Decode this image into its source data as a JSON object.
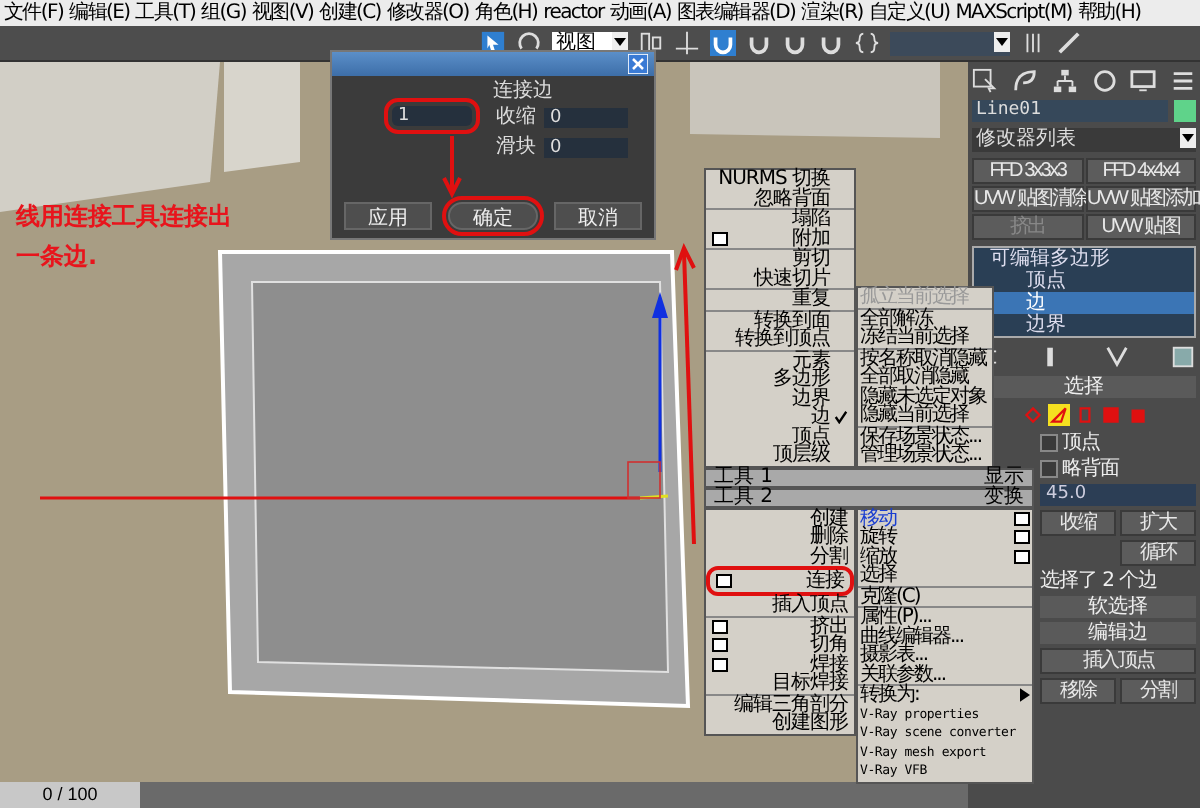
{
  "menu_bar": [
    "文件(F)",
    "编辑(E)",
    "工具(T)",
    "组(G)",
    "视图(V)",
    "创建(C)",
    "修改器(O)",
    "角色(H)",
    "reactor",
    "动画(A)",
    "图表编辑器(D)",
    "渲染(R)",
    "自定义(U)",
    "MAXScript(M)",
    "帮助(H)"
  ],
  "toolbar": {
    "view_dropdown": "视图"
  },
  "dialog": {
    "section_title": "连接边",
    "segments_value": "1",
    "segments_circled": true,
    "fields": [
      {
        "label": "收缩",
        "value": "0"
      },
      {
        "label": "滑块",
        "value": "0"
      }
    ],
    "buttons": [
      {
        "label": "应用",
        "circled": false
      },
      {
        "label": "确定",
        "circled": true
      },
      {
        "label": "取消",
        "circled": false
      }
    ]
  },
  "annotation": "线用连接工具连接出一条边.",
  "quad_menu": {
    "quadrants": [
      {
        "title": "工具 1",
        "groups": [
          [
            {
              "label": "NURMS 切换",
              "settings": false,
              "checked": false
            },
            {
              "label": "忽略背面",
              "settings": false,
              "checked": false
            }
          ],
          [
            {
              "label": "塌陷",
              "settings": false,
              "checked": false
            },
            {
              "label": "附加",
              "settings": true,
              "checked": false
            }
          ],
          [
            {
              "label": "剪切",
              "settings": false,
              "checked": false
            },
            {
              "label": "快速切片",
              "settings": false,
              "checked": false
            }
          ],
          [
            {
              "label": "重复",
              "settings": false,
              "checked": false
            }
          ],
          [
            {
              "label": "转换到面",
              "settings": false,
              "checked": false
            },
            {
              "label": "转换到顶点",
              "settings": false,
              "checked": false
            }
          ],
          [
            {
              "label": "元素",
              "settings": false,
              "checked": false
            },
            {
              "label": "多边形",
              "settings": false,
              "checked": false
            },
            {
              "label": "边界",
              "settings": false,
              "checked": false
            },
            {
              "label": "边",
              "settings": false,
              "checked": true
            },
            {
              "label": "顶点",
              "settings": false,
              "checked": false
            },
            {
              "label": "顶层级",
              "settings": false,
              "checked": false
            }
          ]
        ]
      },
      {
        "title": "显示",
        "groups": [
          [
            {
              "label": "孤立当前选择",
              "disabled": true
            }
          ],
          [
            {
              "label": "全部解冻",
              "disabled": false
            },
            {
              "label": "冻结当前选择",
              "disabled": false
            }
          ],
          [
            {
              "label": "按名称取消隐藏",
              "disabled": false
            },
            {
              "label": "全部取消隐藏",
              "disabled": false
            },
            {
              "label": "隐藏未选定对象",
              "disabled": false
            },
            {
              "label": "隐藏当前选择",
              "disabled": false
            }
          ],
          [
            {
              "label": "保存场景状态...",
              "disabled": false
            },
            {
              "label": "管理场景状态...",
              "disabled": false
            }
          ]
        ]
      },
      {
        "title": "工具 2",
        "groups": [
          [
            {
              "label": "创建",
              "settings": false,
              "circled": false
            },
            {
              "label": "删除",
              "settings": false,
              "circled": false
            },
            {
              "label": "分割",
              "settings": false,
              "circled": false
            },
            {
              "label": "连接",
              "settings": true,
              "circled": true
            },
            {
              "label": "插入顶点",
              "settings": false,
              "circled": false
            }
          ],
          [
            {
              "label": "挤出",
              "settings": true,
              "circled": false
            },
            {
              "label": "切角",
              "settings": true,
              "circled": false
            },
            {
              "label": "焊接",
              "settings": true,
              "circled": false
            },
            {
              "label": "目标焊接",
              "settings": false,
              "circled": false
            }
          ],
          [
            {
              "label": "编辑三角剖分",
              "settings": false,
              "circled": false
            },
            {
              "label": "创建图形",
              "settings": false,
              "circled": false
            }
          ]
        ]
      },
      {
        "title": "变换",
        "groups": [
          [
            {
              "label": "移动",
              "settings": true,
              "selected": true,
              "submenu": false
            },
            {
              "label": "旋转",
              "settings": true,
              "selected": false,
              "submenu": false
            },
            {
              "label": "缩放",
              "settings": true,
              "selected": false,
              "submenu": false
            },
            {
              "label": "选择",
              "settings": false,
              "selected": false,
              "submenu": false
            }
          ],
          [
            {
              "label": "克隆(C)",
              "settings": false,
              "selected": false,
              "submenu": false
            }
          ],
          [
            {
              "label": "属性(P)...",
              "settings": false,
              "selected": false,
              "submenu": false
            },
            {
              "label": "曲线编辑器...",
              "settings": false,
              "selected": false,
              "submenu": false
            },
            {
              "label": "摄影表...",
              "settings": false,
              "selected": false,
              "submenu": false
            },
            {
              "label": "关联参数...",
              "settings": false,
              "selected": false,
              "submenu": false
            }
          ],
          [
            {
              "label": "转换为:",
              "settings": false,
              "selected": false,
              "submenu": true
            },
            {
              "label": "V-Ray properties",
              "settings": false,
              "selected": false,
              "submenu": false
            },
            {
              "label": "V-Ray scene converter",
              "settings": false,
              "selected": false,
              "submenu": false
            },
            {
              "label": "V-Ray mesh export",
              "settings": false,
              "selected": false,
              "submenu": false
            },
            {
              "label": "V-Ray VFB",
              "settings": false,
              "selected": false,
              "submenu": false
            }
          ]
        ]
      }
    ]
  },
  "command_panel": {
    "object_name": "Line01",
    "modifier_list": "修改器列表",
    "modifier_buttons": [
      {
        "label": "FFD 3x3x3",
        "disabled": false
      },
      {
        "label": "FFD 4x4x4",
        "disabled": false
      },
      {
        "label": "UVW 贴图清除",
        "disabled": false
      },
      {
        "label": "UVW 贴图添加",
        "disabled": false
      },
      {
        "label": "挤出",
        "disabled": true
      },
      {
        "label": "UVW 贴图",
        "disabled": false
      }
    ],
    "stack": [
      {
        "label": "可编辑多边形",
        "kind": "object",
        "selected": false
      },
      {
        "label": "顶点",
        "kind": "sub",
        "selected": false
      },
      {
        "label": "边",
        "kind": "sub",
        "selected": true
      },
      {
        "label": "边界",
        "kind": "sub",
        "selected": false
      }
    ],
    "rollout_title": "选择",
    "selection_levels": [
      {
        "selected": false
      },
      {
        "selected": true
      },
      {
        "selected": false
      },
      {
        "selected": false
      },
      {
        "selected": false
      }
    ],
    "checkboxes": [
      {
        "label": "顶点",
        "checked": false
      },
      {
        "label": "略背面",
        "checked": false
      }
    ],
    "angle_value": "45.0",
    "grow_buttons": [
      "收缩",
      "扩大"
    ],
    "loop_button": "循环",
    "selection_info": "选择了 2 个边",
    "rollouts": [
      "软选择",
      "编辑边"
    ],
    "insert_button": "插入顶点",
    "edge_buttons": [
      "移除",
      "分割"
    ]
  },
  "timeline": {
    "label": "0 / 100",
    "level": 0
  }
}
